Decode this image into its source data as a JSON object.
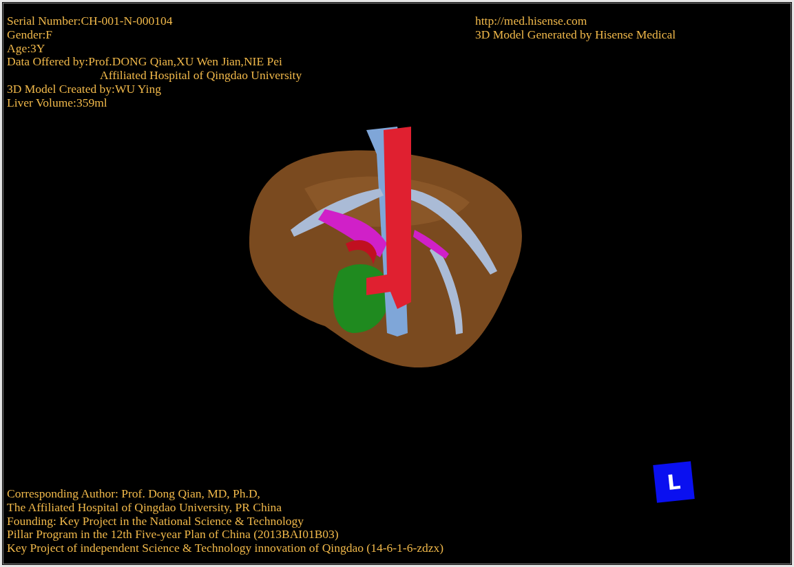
{
  "header_left": [
    {
      "kind": "line",
      "text": "Serial Number:CH-001-N-000104"
    },
    {
      "kind": "line",
      "text": "Gender:F"
    },
    {
      "kind": "line",
      "text": "Age:3Y"
    },
    {
      "kind": "line",
      "text": "Data Offered by:Prof.DONG Qian,XU Wen Jian,NIE Pei"
    },
    {
      "kind": "indent",
      "text": "Affiliated Hospital of Qingdao University"
    },
    {
      "kind": "line",
      "text": "3D Model Created by:WU Ying"
    },
    {
      "kind": "line",
      "text": "Liver Volume:359ml"
    }
  ],
  "header_right": [
    "http://med.hisense.com",
    "3D Model Generated by Hisense Medical"
  ],
  "orientation_marker": {
    "label": "L"
  },
  "footer_lines": [
    "Corresponding Author: Prof. Dong Qian, MD, Ph.D,",
    "The Affiliated Hospital of Qingdao University, PR China",
    "Founding: Key Project in the National Science & Technology",
    "Pillar Program in the 12th Five-year Plan of China (2013BAI01B03)",
    "Key Project of independent Science & Technology innovation of Qingdao (14-6-1-6-zdzx)"
  ]
}
